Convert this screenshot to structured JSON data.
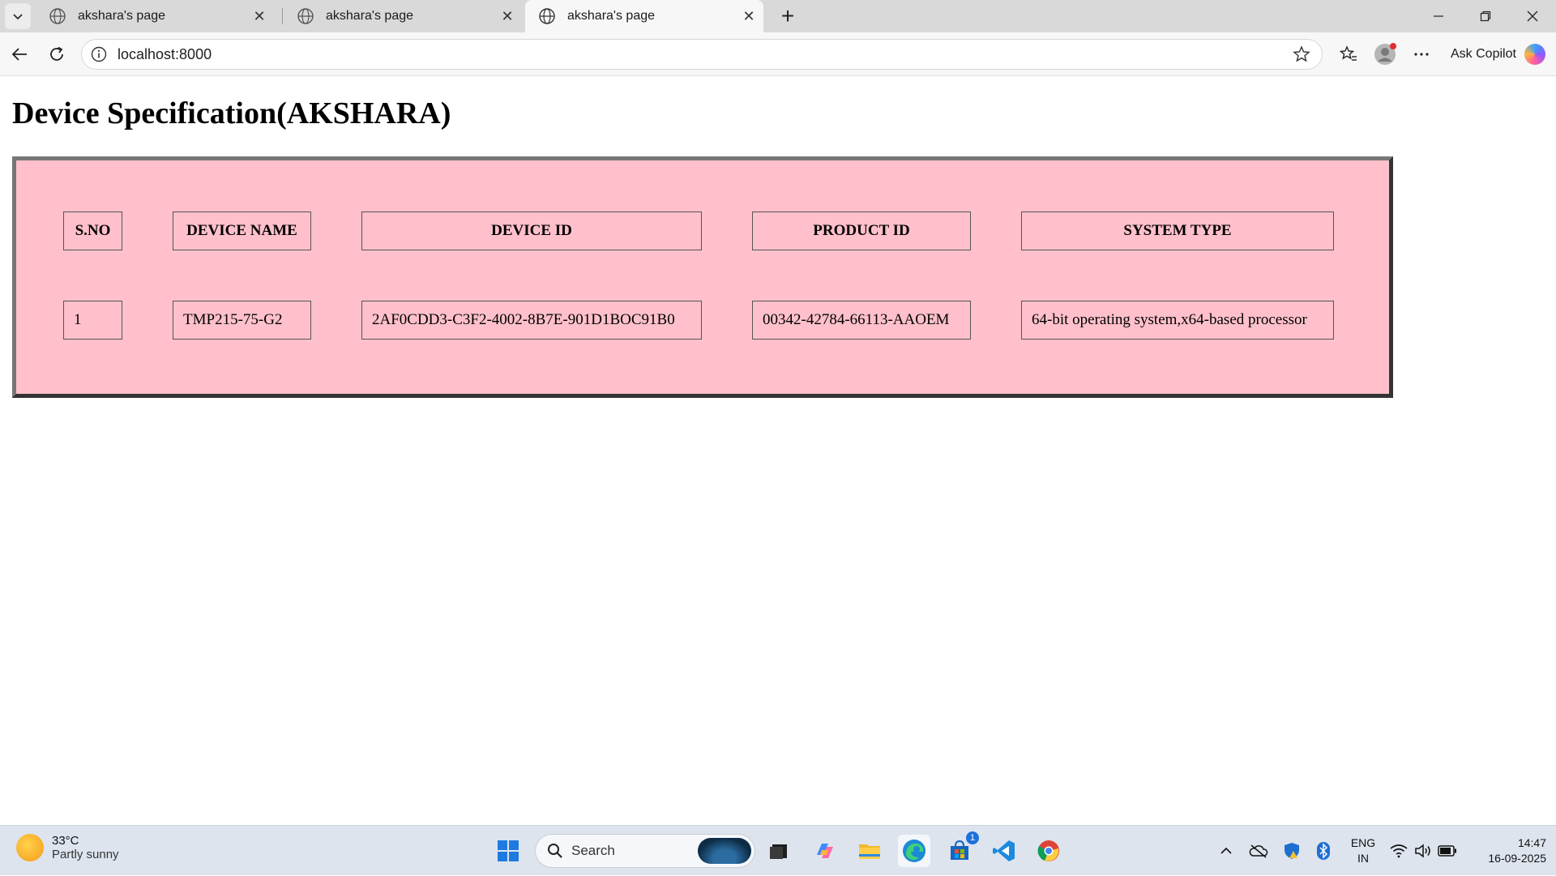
{
  "browser": {
    "tabs": [
      {
        "title": "akshara's page",
        "active": false
      },
      {
        "title": "akshara's page",
        "active": false
      },
      {
        "title": "akshara's page",
        "active": true
      }
    ],
    "address": "localhost:8000",
    "copilot_label": "Ask Copilot"
  },
  "page": {
    "title": "Device Specification(AKSHARA)",
    "table": {
      "headers": [
        "S.NO",
        "DEVICE NAME",
        "DEVICE ID",
        "PRODUCT ID",
        "SYSTEM TYPE"
      ],
      "rows": [
        [
          "1",
          "TMP215-75-G2",
          "2AF0CDD3-C3F2-4002-8B7E-901D1BOC91B0",
          "00342-42784-66113-AAOEM",
          "64-bit operating system,x64-based processor"
        ]
      ],
      "background": "#ffc0cb"
    }
  },
  "taskbar": {
    "weather": {
      "temp": "33°C",
      "condition": "Partly sunny"
    },
    "search_label": "Search",
    "store_badge": "1",
    "lang": {
      "line1": "ENG",
      "line2": "IN"
    },
    "clock": {
      "time": "14:47",
      "date": "16-09-2025"
    }
  }
}
